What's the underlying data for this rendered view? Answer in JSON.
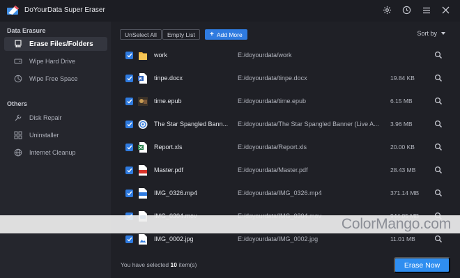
{
  "app": {
    "title": "DoYourData Super Eraser",
    "accent": "#2f7be0",
    "titlebar_icons": [
      "gear-icon",
      "history-icon",
      "menu-icon",
      "close-icon"
    ]
  },
  "sidebar": {
    "section1": "Data Erasure",
    "section2": "Others",
    "items": [
      {
        "label": "Erase Files/Folders",
        "icon": "eraser-icon",
        "active": true
      },
      {
        "label": "Wipe Hard Drive",
        "icon": "hard-drive-icon"
      },
      {
        "label": "Wipe Free Space",
        "icon": "pie-icon"
      },
      {
        "label": "Disk Repair",
        "icon": "wrench-icon"
      },
      {
        "label": "Uninstaller",
        "icon": "grid-icon"
      },
      {
        "label": "Internet Cleanup",
        "icon": "globe-icon"
      }
    ]
  },
  "toolbar": {
    "unselect_all": "UnSelect All",
    "empty_list": "Empty List",
    "add_more": "Add More",
    "sort_by": "Sort by"
  },
  "files": [
    {
      "name": "work",
      "path": "E:/doyourdata/work",
      "size": "",
      "icon": "folder-icon"
    },
    {
      "name": "tinpe.docx",
      "path": "E:/doyourdata/tinpe.docx",
      "size": "19.84 KB",
      "icon": "word-icon"
    },
    {
      "name": "time.epub",
      "path": "E:/doyourdata/time.epub",
      "size": "6.15 MB",
      "icon": "epub-icon"
    },
    {
      "name": "The Star Spangled Bann...",
      "path": "E:/doyourdata/The Star Spangled Banner (Live A...",
      "size": "3.96 MB",
      "icon": "audio-icon"
    },
    {
      "name": "Report.xls",
      "path": "E:/doyourdata/Report.xls",
      "size": "20.00 KB",
      "icon": "excel-icon"
    },
    {
      "name": "Master.pdf",
      "path": "E:/doyourdata/Master.pdf",
      "size": "28.43 MB",
      "icon": "pdf-icon"
    },
    {
      "name": "IMG_0326.mp4",
      "path": "E:/doyourdata/IMG_0326.mp4",
      "size": "371.14 MB",
      "icon": "mp4-icon"
    },
    {
      "name": "IMG_0304.mov",
      "path": "E:/doyourdata/IMG_0304.mov",
      "size": "944.05 MB",
      "icon": "mov-icon"
    },
    {
      "name": "IMG_0002.jpg",
      "path": "E:/doyourdata/IMG_0002.jpg",
      "size": "11.01 MB",
      "icon": "image-icon"
    }
  ],
  "footer": {
    "selected_prefix": "You have selected",
    "selected_count": "10",
    "selected_suffix": "item(s)",
    "erase_now": "Erase Now"
  },
  "watermark": "ColorMango.com"
}
